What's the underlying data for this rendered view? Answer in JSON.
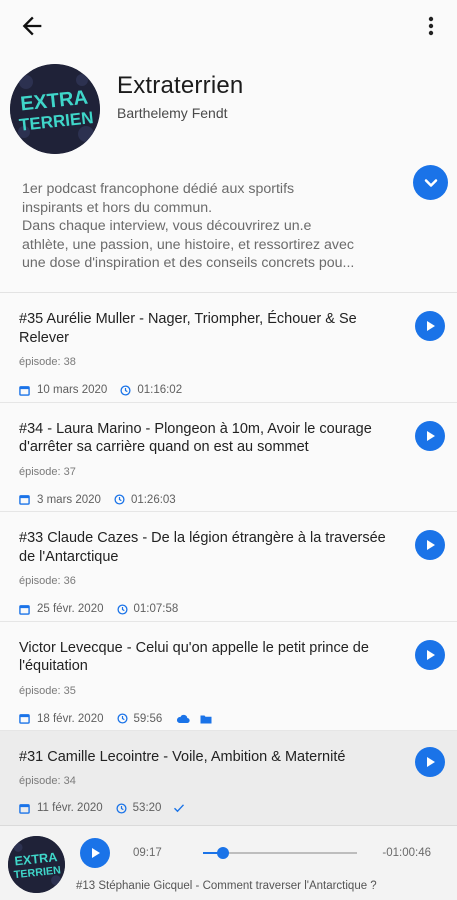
{
  "icons": {
    "back": "arrow-left-icon",
    "menu": "more-vertical-icon",
    "expand": "chevron-down-icon",
    "play": "play-icon",
    "calendar": "calendar-icon",
    "clock": "clock-icon",
    "cloud": "cloud-icon",
    "folder": "folder-icon",
    "played": "check-icon"
  },
  "colors": {
    "accent": "#1a73e8",
    "cover_bg": "#1f2238",
    "cover_text": "#3fd6c9"
  },
  "podcast": {
    "title": "Extraterrien",
    "author": "Barthelemy Fendt",
    "cover_text_line1": "EXTRA",
    "cover_text_line2": "TERRIEN",
    "description": "1er podcast francophone dédié aux sportifs\ninspirants et hors du commun.\nDans chaque interview, vous découvrirez un.e\nathlète, une passion, une histoire, et ressortirez avec\nune dose d'inspiration et des conseils concrets pou..."
  },
  "episodes": [
    {
      "title": "#35 Aurélie Muller - Nager, Triompher, Échouer & Se Relever",
      "number": "épisode: 38",
      "date": "10 mars 2020",
      "duration": "01:16:02",
      "downloaded": false,
      "played": false,
      "selected": false
    },
    {
      "title": "#34 - Laura Marino - Plongeon à 10m, Avoir le courage d'arrêter sa carrière quand on est au sommet",
      "number": "épisode: 37",
      "date": "3 mars 2020",
      "duration": "01:26:03",
      "downloaded": false,
      "played": false,
      "selected": false
    },
    {
      "title": "#33 Claude Cazes - De la légion étrangère à la traversée de l'Antarctique",
      "number": "épisode: 36",
      "date": "25 févr. 2020",
      "duration": "01:07:58",
      "downloaded": false,
      "played": false,
      "selected": false
    },
    {
      "title": "Victor Levecque - Celui qu'on appelle le petit prince de l'équitation",
      "number": "épisode: 35",
      "date": "18 févr. 2020",
      "duration": "59:56",
      "downloaded": true,
      "played": false,
      "selected": false
    },
    {
      "title": "#31 Camille Lecointre - Voile, Ambition & Maternité",
      "number": "épisode: 34",
      "date": "11 févr. 2020",
      "duration": "53:20",
      "downloaded": false,
      "played": true,
      "selected": true
    }
  ],
  "player": {
    "elapsed": "09:17",
    "remaining": "-01:00:46",
    "progress": 0.13,
    "now_playing": "#13 Stéphanie Gicquel - Comment traverser l'Antarctique ?"
  }
}
